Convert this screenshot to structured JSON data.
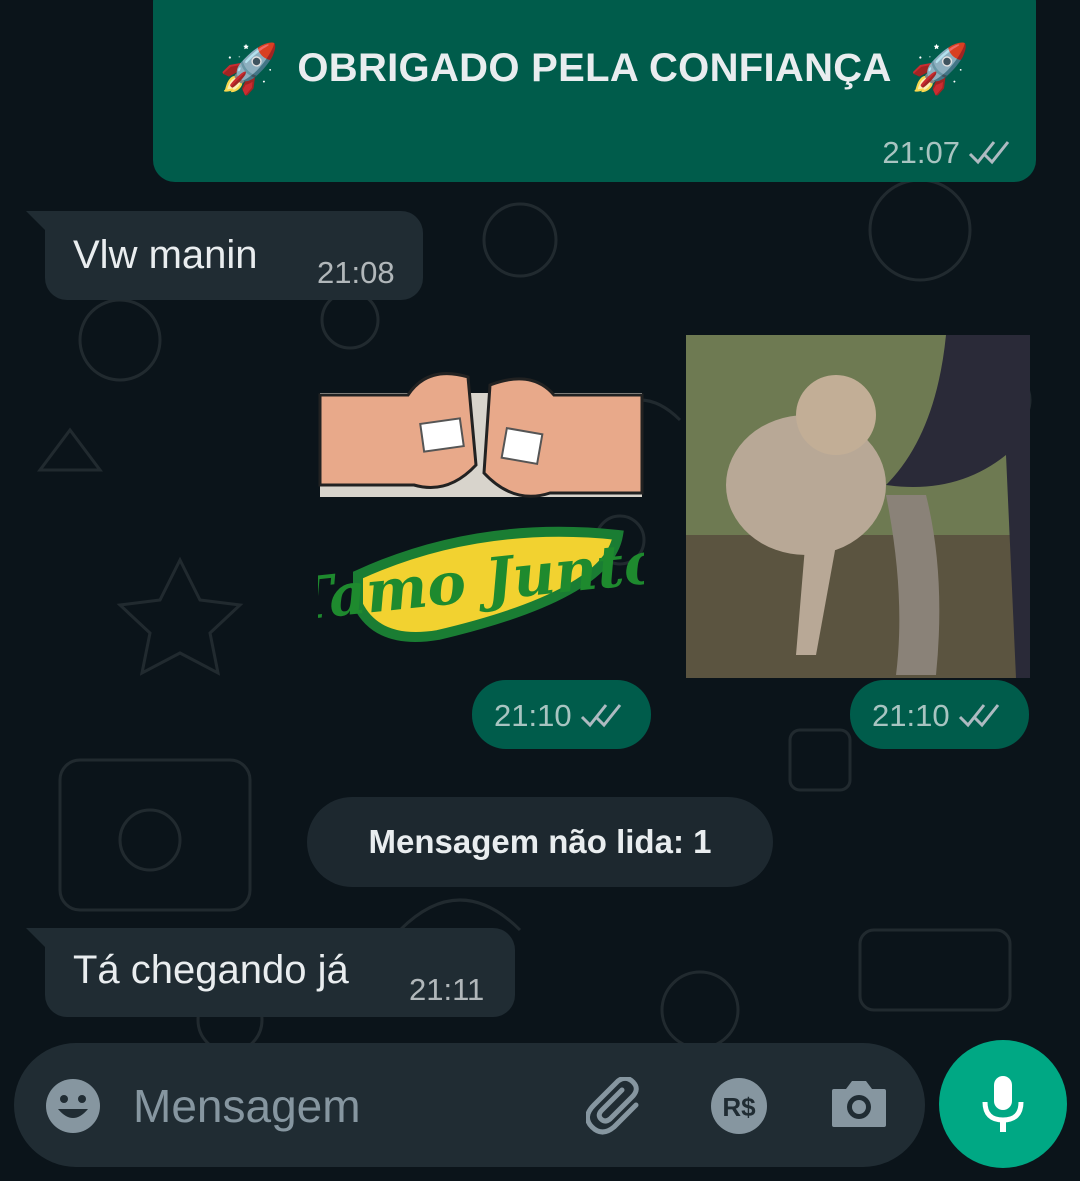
{
  "messages": [
    {
      "dir": "out",
      "text": "OBRIGADO PELA CONFIANÇA",
      "emoji": "🚀",
      "time": "21:07",
      "status": "read"
    },
    {
      "dir": "in",
      "text": "Vlw manin",
      "time": "21:08"
    },
    {
      "dir": "out",
      "type": "sticker",
      "sticker_text": "Tamo Junto",
      "time": "21:10",
      "status": "read"
    },
    {
      "dir": "out",
      "type": "gif",
      "time": "21:10",
      "status": "read"
    },
    {
      "dir": "in",
      "text": "Tá chegando já",
      "time": "21:11"
    }
  ],
  "unread_divider": "Mensagem não lida: 1",
  "composer": {
    "placeholder": "Mensagem"
  },
  "icons": [
    "emoji-icon",
    "attach-icon",
    "payment-icon",
    "camera-icon",
    "mic-icon",
    "double-check-icon"
  ],
  "colors": {
    "background": "#0b141a",
    "outgoing": "#005c4b",
    "incoming": "#202c33",
    "accent": "#00a884"
  }
}
